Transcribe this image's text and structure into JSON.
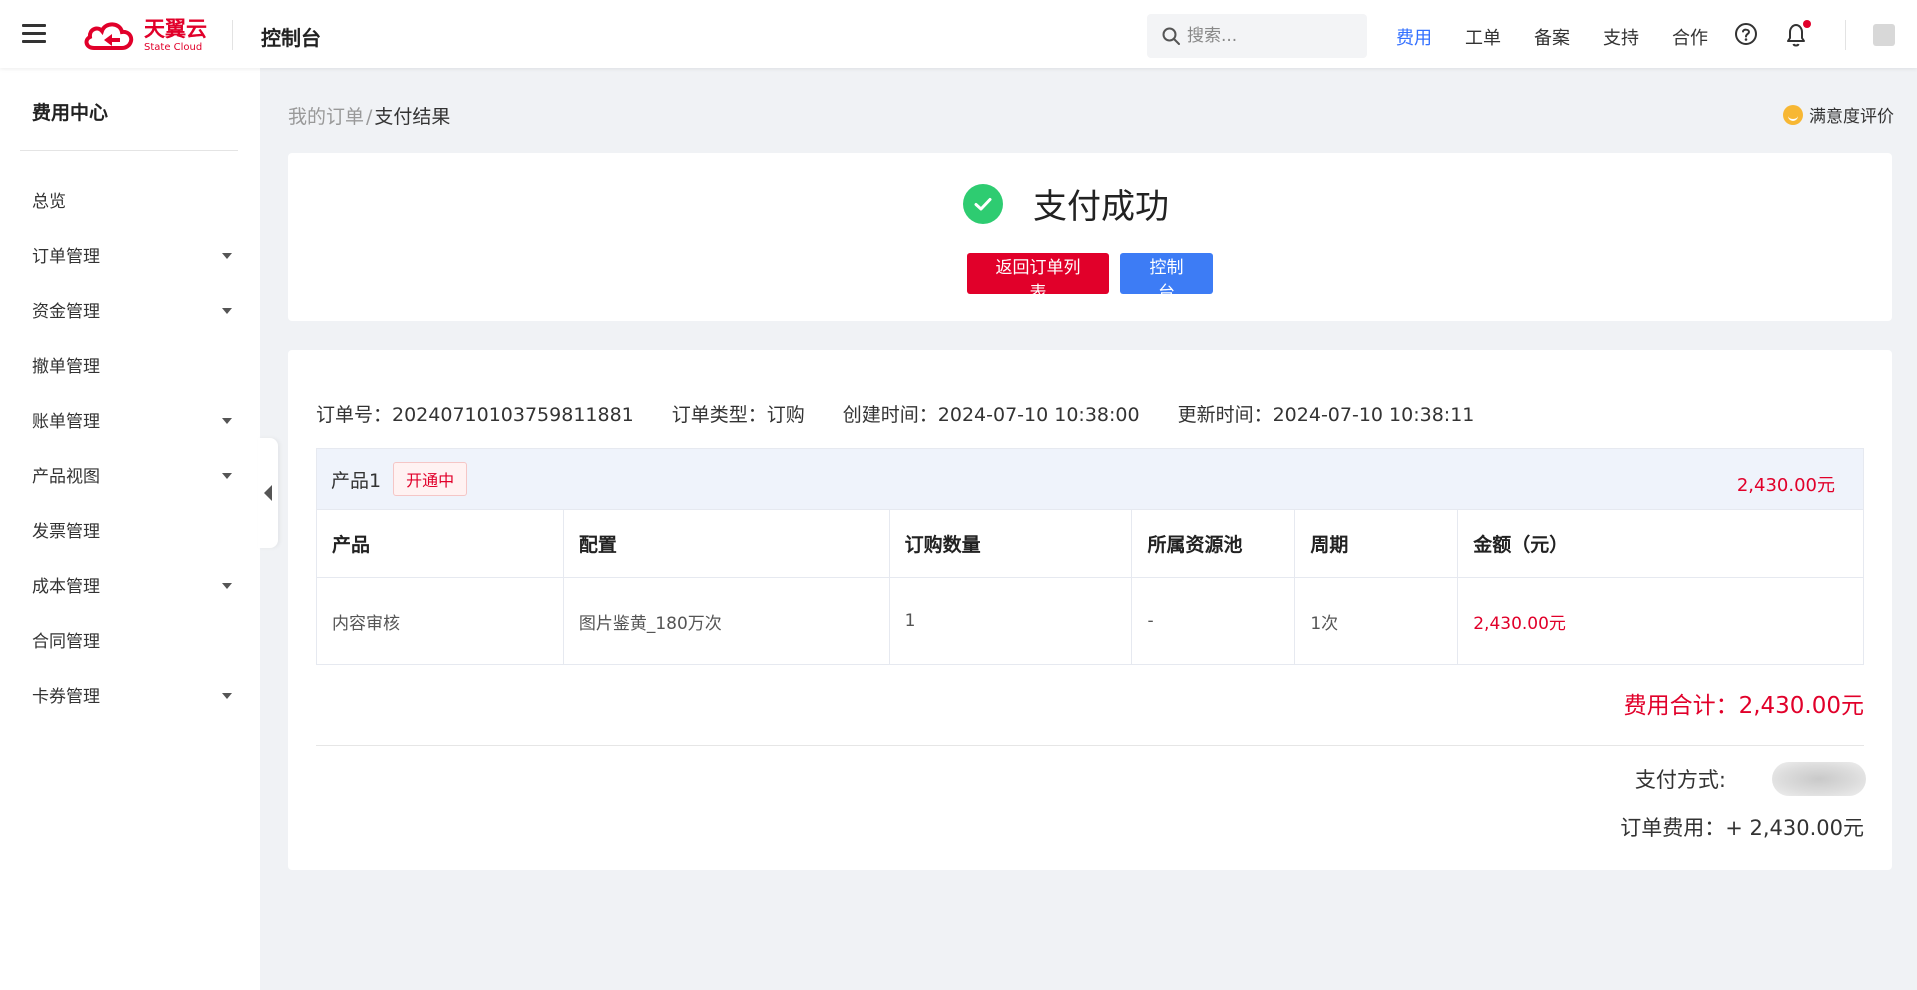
{
  "header": {
    "logo_cn": "天翼云",
    "logo_en": "State Cloud",
    "console_title": "控制台",
    "search_placeholder": "搜索...",
    "nav": [
      "费用",
      "工单",
      "备案",
      "支持",
      "合作"
    ],
    "active_nav": "费用"
  },
  "sidebar": {
    "title": "费用中心",
    "items": [
      {
        "label": "总览",
        "has_caret": false
      },
      {
        "label": "订单管理",
        "has_caret": true
      },
      {
        "label": "资金管理",
        "has_caret": true
      },
      {
        "label": "撤单管理",
        "has_caret": false
      },
      {
        "label": "账单管理",
        "has_caret": true
      },
      {
        "label": "产品视图",
        "has_caret": true
      },
      {
        "label": "发票管理",
        "has_caret": false
      },
      {
        "label": "成本管理",
        "has_caret": true
      },
      {
        "label": "合同管理",
        "has_caret": false
      },
      {
        "label": "卡券管理",
        "has_caret": true
      }
    ]
  },
  "breadcrumb": {
    "parent": "我的订单",
    "separator": "/",
    "current": "支付结果"
  },
  "satisfaction_label": "满意度评价",
  "result": {
    "title": "支付成功",
    "back_button": "返回订单列表",
    "console_button": "控制台"
  },
  "order": {
    "order_no": "订单号：20240710103759811881",
    "order_type": "订单类型：订购",
    "created": "创建时间：2024-07-10 10:38:00",
    "updated": "更新时间：2024-07-10 10:38:11",
    "product_name": "产品1",
    "status": "开通中",
    "product_amount": "2,430.00元",
    "columns": [
      "产品",
      "配置",
      "订购数量",
      "所属资源池",
      "周期",
      "金额（元）"
    ],
    "rows": [
      [
        "内容审核",
        "图片鉴黄_180万次",
        "1",
        "-",
        "1次",
        "2,430.00元"
      ]
    ],
    "total": "费用合计：2,430.00元",
    "pay_method_label": "支付方式:",
    "order_fee": "订单费用：+ 2,430.00元"
  },
  "colors": {
    "brand_red": "#e1002a",
    "primary_blue": "#3d7cf5",
    "success_green": "#2ecc71"
  }
}
